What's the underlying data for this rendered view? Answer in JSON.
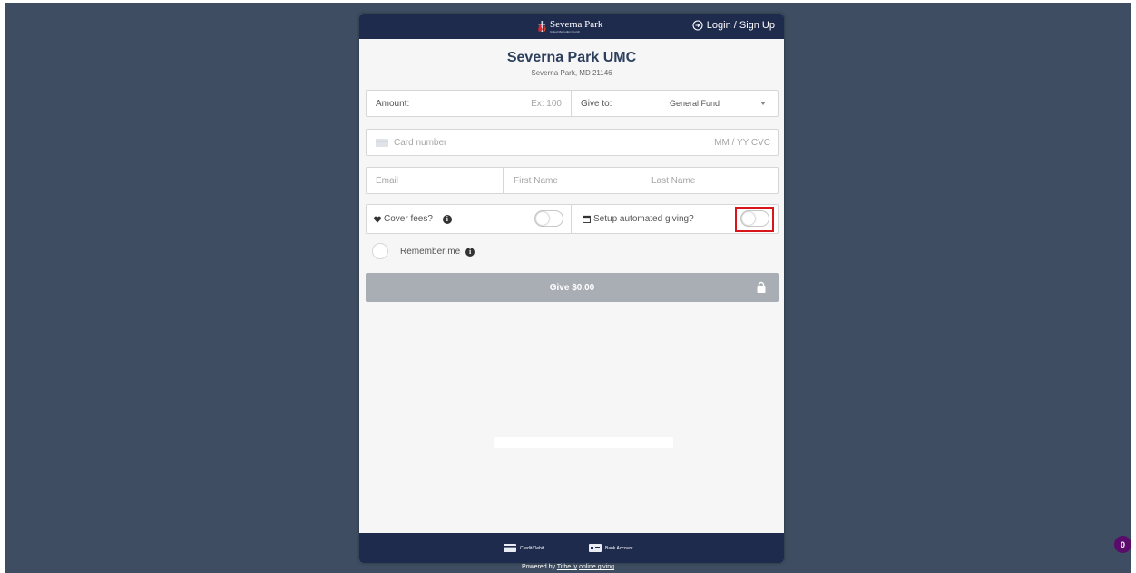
{
  "header": {
    "logo_name": "Severna Park",
    "logo_sub": "United Methodist Church",
    "login_label": "Login / Sign Up"
  },
  "org": {
    "name": "Severna Park UMC",
    "location": "Severna Park, MD 21146"
  },
  "form": {
    "amount_label": "Amount:",
    "amount_placeholder": "Ex: 100",
    "give_to_label": "Give to:",
    "give_to_value": "General Fund",
    "card_number_placeholder": "Card number",
    "card_expiry_cvc_placeholder": "MM / YY  CVC",
    "email_placeholder": "Email",
    "first_name_placeholder": "First Name",
    "last_name_placeholder": "Last Name",
    "cover_fees_label": "Cover fees?",
    "cover_fees_on": false,
    "automated_giving_label": "Setup automated giving?",
    "automated_giving_on": false,
    "remember_me_label": "Remember me",
    "give_button_label": "Give $0.00"
  },
  "footer": {
    "credit_label": "Credit/Debit",
    "bank_label": "Bank Account",
    "powered_prefix": "Powered by ",
    "powered_link1": "Tithe.ly",
    "powered_link2": "online giving"
  },
  "badge": {
    "count": "0"
  },
  "colors": {
    "page_background": "#3e4d61",
    "header_navy": "#1f2b4d",
    "button_disabled": "#a9adb4",
    "highlight": "#d7151b",
    "badge": "#5a0b6b"
  }
}
